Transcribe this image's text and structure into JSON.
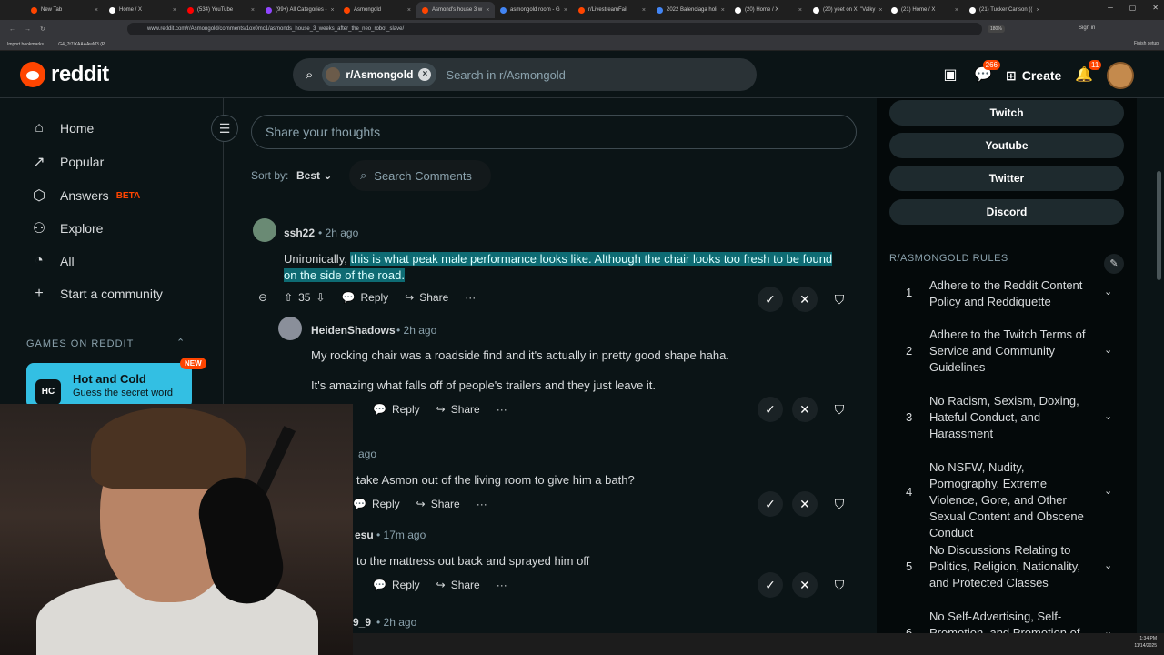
{
  "browser": {
    "tabs": [
      {
        "label": "New Tab"
      },
      {
        "label": "Home / X"
      },
      {
        "label": "(534) YouTube"
      },
      {
        "label": "(99+) All Categories -"
      },
      {
        "label": "Asmongold"
      },
      {
        "label": "Asmond's house 3 w"
      },
      {
        "label": "asmongold room - G"
      },
      {
        "label": "r/LivestreamFail"
      },
      {
        "label": "2022 Balenciaga holi"
      },
      {
        "label": "(20) Home / X"
      },
      {
        "label": "(20) yeet on X: \"Valky"
      },
      {
        "label": "(21) Home / X"
      },
      {
        "label": "(21) Tucker Carlson (("
      }
    ],
    "url": "www.reddit.com/r/Asmongold/comments/1ox0mc1/asmonds_house_3_weeks_after_the_neo_robot_slave/",
    "zoom": "180%",
    "sign_in": "Sign in",
    "bookmarks": [
      "Import bookmarks...",
      "G4_7t7lXAAAAwM3 (P..."
    ],
    "finish_setup": "Finish setup"
  },
  "header": {
    "logo_text": "reddit",
    "search_chip": "r/Asmongold",
    "search_placeholder": "Search in r/Asmongold",
    "chat_badge": "266",
    "create_label": "Create",
    "notif_badge": "11"
  },
  "sidebar": {
    "items": [
      {
        "label": "Home",
        "icon": "home-icon"
      },
      {
        "label": "Popular",
        "icon": "popular-icon"
      },
      {
        "label": "Answers",
        "icon": "answers-icon",
        "tag": "BETA"
      },
      {
        "label": "Explore",
        "icon": "explore-icon"
      },
      {
        "label": "All",
        "icon": "all-icon"
      },
      {
        "label": "Start a community",
        "icon": "plus-icon"
      }
    ],
    "games_title": "GAMES ON REDDIT",
    "game": {
      "title": "Hot and Cold",
      "subtitle": "Guess the secret word",
      "badge": "NEW"
    }
  },
  "main": {
    "share_placeholder": "Share your thoughts",
    "sort_label": "Sort by:",
    "sort_value": "Best",
    "search_comments": "Search Comments",
    "comments": [
      {
        "author": "ssh22",
        "time": "2h ago",
        "text_plain": "Unironically,",
        "text_highlight": "this is what peak male performance looks like. Although the chair looks too fresh to be found on the side of the road.",
        "votes": "35",
        "reply": "Reply",
        "share": "Share"
      },
      {
        "author": "HeidenShadows",
        "time": "2h ago",
        "text1": "My rocking chair was a roadside find and it's actually in pretty good shape haha.",
        "text2": "It's amazing what falls off of people's trailers and they just leave it.",
        "reply": "Reply",
        "share": "Share"
      },
      {
        "time": "ago",
        "text": "take Asmon out of the living room to give him a bath?",
        "reply": "Reply",
        "share": "Share"
      },
      {
        "author": "esu",
        "time": "17m ago",
        "text": "to the mattress out back and sprayed him off",
        "reply": "Reply",
        "share": "Share"
      },
      {
        "author": "9_9",
        "time": "2h ago"
      }
    ]
  },
  "right": {
    "links": [
      "Twitch",
      "Youtube",
      "Twitter",
      "Discord"
    ],
    "rules_title": "R/ASMONGOLD RULES",
    "rules": [
      {
        "num": "1",
        "text": "Adhere to the Reddit Content Policy and Reddiquette"
      },
      {
        "num": "2",
        "text": "Adhere to the Twitch Terms of Service and Community Guidelines"
      },
      {
        "num": "3",
        "text": "No Racism, Sexism, Doxing, Hateful Conduct, and Harassment"
      },
      {
        "num": "4",
        "text": "No NSFW, Nudity, Pornography, Extreme Violence, Gore, and Other Sexual Content and Obscene Conduct"
      },
      {
        "num": "5",
        "text": "No Discussions Relating to Politics, Religion, Nationality, and Protected Classes"
      },
      {
        "num": "6",
        "text": "No Self-Advertising, Self-Promotion, and Promotion of"
      }
    ]
  },
  "taskbar": {
    "time": "1:34 PM",
    "date": "11/14/2025"
  },
  "colors": {
    "brand": "#ff4500",
    "highlight": "#0e6b73",
    "bg": "#0b1416"
  }
}
